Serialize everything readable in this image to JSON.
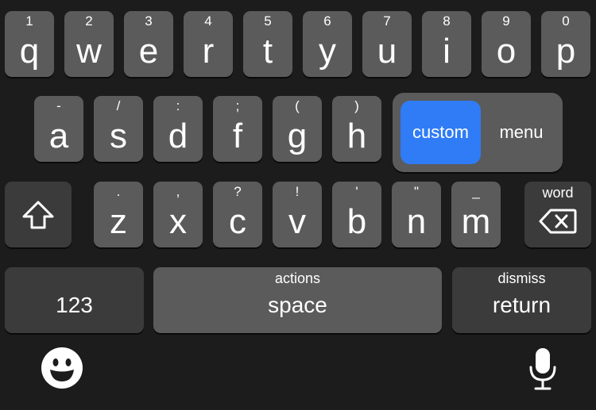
{
  "row1": [
    {
      "hint": "1",
      "letter": "q"
    },
    {
      "hint": "2",
      "letter": "w"
    },
    {
      "hint": "3",
      "letter": "e"
    },
    {
      "hint": "4",
      "letter": "r"
    },
    {
      "hint": "5",
      "letter": "t"
    },
    {
      "hint": "6",
      "letter": "y"
    },
    {
      "hint": "7",
      "letter": "u"
    },
    {
      "hint": "8",
      "letter": "i"
    },
    {
      "hint": "9",
      "letter": "o"
    },
    {
      "hint": "0",
      "letter": "p"
    }
  ],
  "row2": [
    {
      "hint": "-",
      "letter": "a"
    },
    {
      "hint": "/",
      "letter": "s"
    },
    {
      "hint": ":",
      "letter": "d"
    },
    {
      "hint": ";",
      "letter": "f"
    },
    {
      "hint": "(",
      "letter": "g"
    },
    {
      "hint": ")",
      "letter": "h"
    }
  ],
  "row3": [
    {
      "hint": ".",
      "letter": "z"
    },
    {
      "hint": ",",
      "letter": "x"
    },
    {
      "hint": "?",
      "letter": "c"
    },
    {
      "hint": "!",
      "letter": "v"
    },
    {
      "hint": "'",
      "letter": "b"
    },
    {
      "hint": "\"",
      "letter": "n"
    },
    {
      "hint": "_",
      "letter": "m"
    }
  ],
  "popup": {
    "selected": "custom",
    "other": "menu"
  },
  "delete": {
    "hint": "word"
  },
  "bottom": {
    "numbers_label": "123",
    "space_hint": "actions",
    "space_label": "space",
    "return_hint": "dismiss",
    "return_label": "return"
  },
  "icons": {
    "shift": "shift-icon",
    "delete": "backspace-icon",
    "emoji": "emoji-icon",
    "mic": "microphone-icon"
  },
  "colors": {
    "background": "#1c1c1c",
    "key": "#5b5b5b",
    "special_key": "#3b3b3b",
    "accent": "#2f7cf6"
  }
}
